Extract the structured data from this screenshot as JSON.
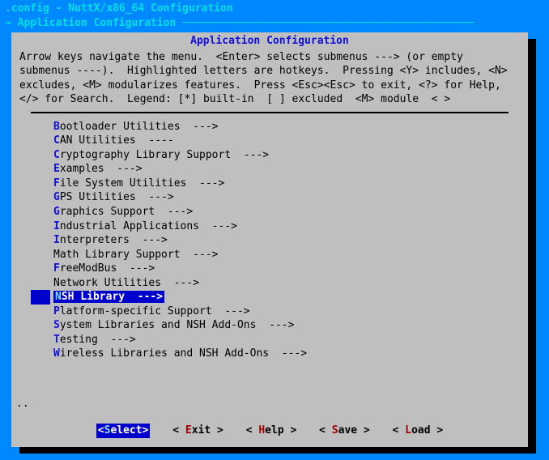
{
  "header": {
    "line1": ".config - NuttX/x86_64 Configuration",
    "line2_prefix": "→ ",
    "line2": "Application Configuration",
    "dashes": " ──────────────────────────────────────────────"
  },
  "panel": {
    "title": "Application Configuration",
    "help": "Arrow keys navigate the menu.  <Enter> selects submenus ---> (or empty submenus ----).  Highlighted letters are hotkeys.  Pressing <Y> includes, <N> excludes, <M> modularizes features.  Press <Esc><Esc> to exit, <?> for Help, </> for Search.  Legend: [*] built-in  [ ] excluded  <M> module  < >"
  },
  "menu": {
    "items": [
      {
        "hot": "B",
        "rest": "ootloader Utilities  --->",
        "selected": false
      },
      {
        "hot": "C",
        "rest": "AN Utilities  ----",
        "selected": false
      },
      {
        "hot": "C",
        "rest": "ryptography Library Support  --->",
        "selected": false
      },
      {
        "hot": "E",
        "rest": "xamples  --->",
        "selected": false
      },
      {
        "hot": "F",
        "rest": "ile System Utilities  --->",
        "selected": false
      },
      {
        "hot": "G",
        "rest": "PS Utilities  --->",
        "selected": false
      },
      {
        "hot": "G",
        "rest": "raphics Support  --->",
        "selected": false
      },
      {
        "hot": "I",
        "rest": "ndustrial Applications  --->",
        "selected": false
      },
      {
        "hot": "I",
        "rest": "nterpreters  --->",
        "selected": false
      },
      {
        "hot": "M",
        "rest": "ath Library Support  --->",
        "selected": false,
        "hot_plain": true
      },
      {
        "hot": "F",
        "rest": "reeModBus  --->",
        "selected": false
      },
      {
        "hot": "N",
        "rest": "etwork Utilities  --->",
        "selected": false,
        "hot_plain": true
      },
      {
        "hot": "N",
        "rest": "SH Library  --->",
        "selected": true
      },
      {
        "hot": "P",
        "rest": "latform-specific Support  --->",
        "selected": false
      },
      {
        "hot": "S",
        "rest": "ystem Libraries and NSH Add-Ons  --->",
        "selected": false
      },
      {
        "hot": "T",
        "rest": "esting  --->",
        "selected": false
      },
      {
        "hot": "W",
        "rest": "ireless Libraries and NSH Add-Ons  --->",
        "selected": false
      }
    ],
    "trailing": ".."
  },
  "buttons": {
    "select": {
      "open": "<",
      "hot": "S",
      "rest": "elect>",
      "selected": true
    },
    "exit": {
      "open": "< ",
      "hot": "E",
      "rest": "xit >",
      "selected": false
    },
    "help": {
      "open": "< ",
      "hot": "H",
      "rest": "elp >",
      "selected": false
    },
    "save": {
      "open": "< ",
      "hot": "S",
      "rest": "ave >",
      "selected": false
    },
    "load": {
      "open": "< ",
      "hot": "L",
      "rest": "oad >",
      "selected": false
    }
  }
}
